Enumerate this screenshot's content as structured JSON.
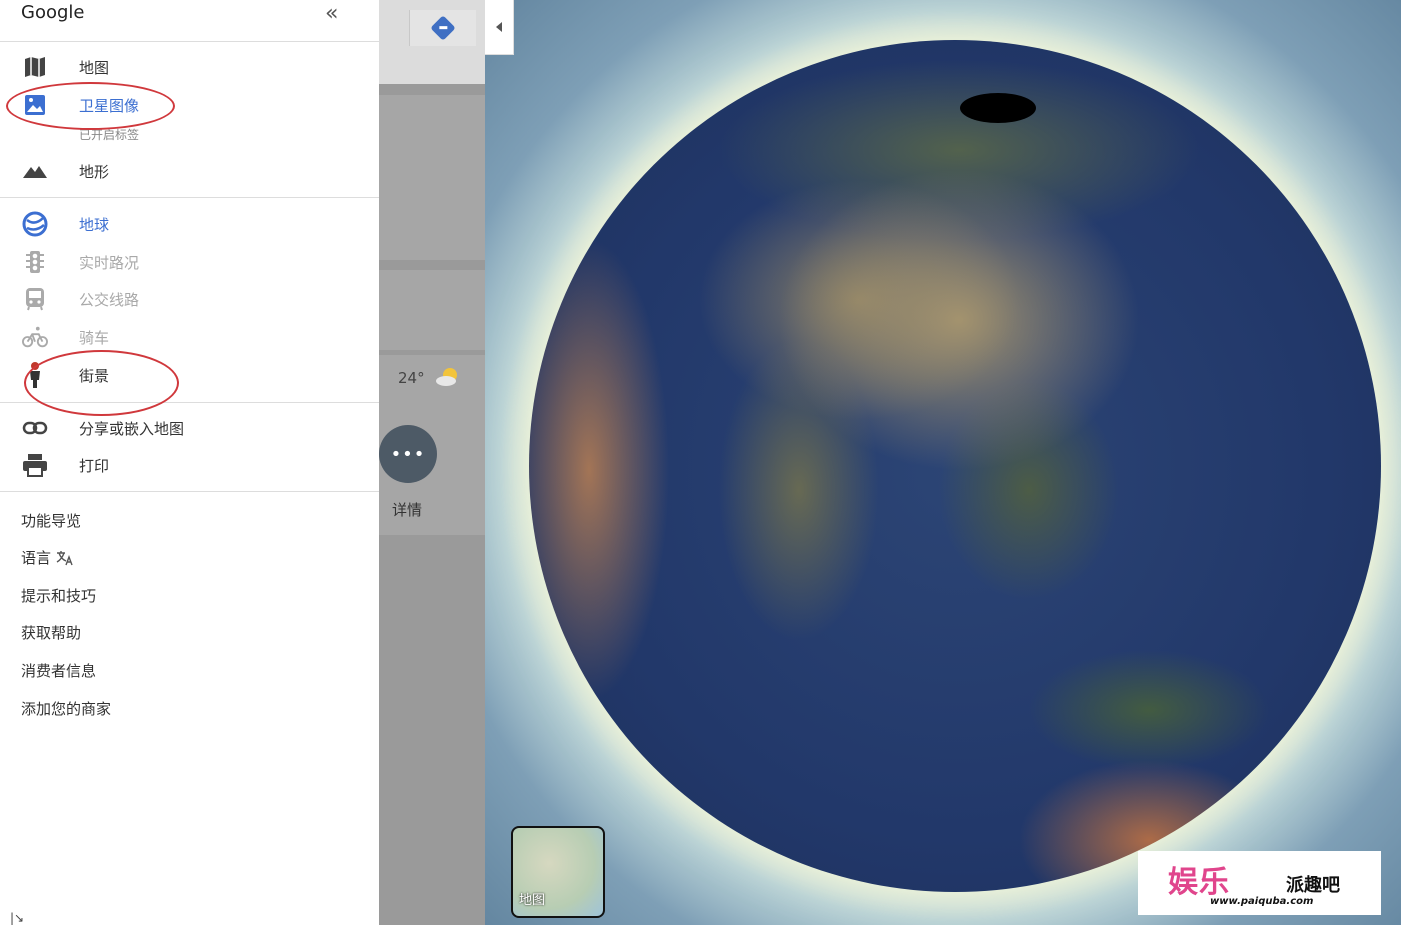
{
  "menu": {
    "logo": "Google",
    "collapse": "«",
    "layers": [
      {
        "label": "地图",
        "icon": "map-icon"
      },
      {
        "label": "卫星图像",
        "icon": "satellite-icon",
        "sub": "已开启标签"
      },
      {
        "label": "地形",
        "icon": "terrain-icon"
      }
    ],
    "overlays": [
      {
        "label": "地球",
        "icon": "globe-icon"
      },
      {
        "label": "实时路况",
        "icon": "traffic-icon"
      },
      {
        "label": "公交线路",
        "icon": "transit-icon"
      },
      {
        "label": "骑车",
        "icon": "bicycle-icon"
      },
      {
        "label": "街景",
        "icon": "pegman-icon"
      }
    ],
    "actions": [
      {
        "label": "分享或嵌入地图",
        "icon": "link-icon"
      },
      {
        "label": "打印",
        "icon": "print-icon"
      }
    ],
    "links": [
      "功能导览",
      "语言",
      "提示和技巧",
      "获取帮助",
      "消费者信息",
      "添加您的商家"
    ]
  },
  "panel": {
    "temperature": "24°",
    "details_label": "详情",
    "more_glyph": "•••"
  },
  "map": {
    "thumbnail_label": "地图"
  },
  "watermark": {
    "left": "娱乐",
    "right": "派趣吧",
    "url": "www.paiquba.com"
  },
  "colors": {
    "accent_blue": "#3c6fd1",
    "annotation_red": "#d0383c"
  }
}
